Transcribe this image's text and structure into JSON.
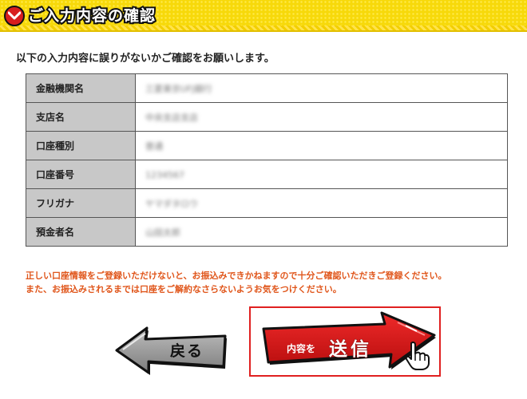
{
  "header": {
    "title": "ご入力内容の確認",
    "icon": "chevron-down-circle-icon",
    "colors": {
      "banner": "#f7d90a",
      "icon_bg": "#d81e1e"
    }
  },
  "intro": "以下の入力内容に誤りがないかご確認をお願いします。",
  "fields": [
    {
      "label": "金融機関名",
      "value": "三菱東京UFJ銀行"
    },
    {
      "label": "支店名",
      "value": "中央支店支店"
    },
    {
      "label": "口座種別",
      "value": "普通"
    },
    {
      "label": "口座番号",
      "value": "1234567"
    },
    {
      "label": "フリガナ",
      "value": "ヤマダタロウ"
    },
    {
      "label": "預金者名",
      "value": "山田太郎"
    }
  ],
  "notice": {
    "line1": "正しい口座情報をご登録いただけないと、お振込みできかねますので十分ご確認いただきご登録ください。",
    "line2": "また、お振込みされるまでは口座をご解約なさらないようお気をつけください。",
    "color": "#e0561b"
  },
  "buttons": {
    "back": {
      "label": "戻る",
      "icon": "left-arrow-icon"
    },
    "send": {
      "prefix": "内容を",
      "label": "送信",
      "icon": "right-arrow-icon",
      "cursor_icon": "pointing-hand-icon",
      "color": "#d81e1e"
    }
  }
}
